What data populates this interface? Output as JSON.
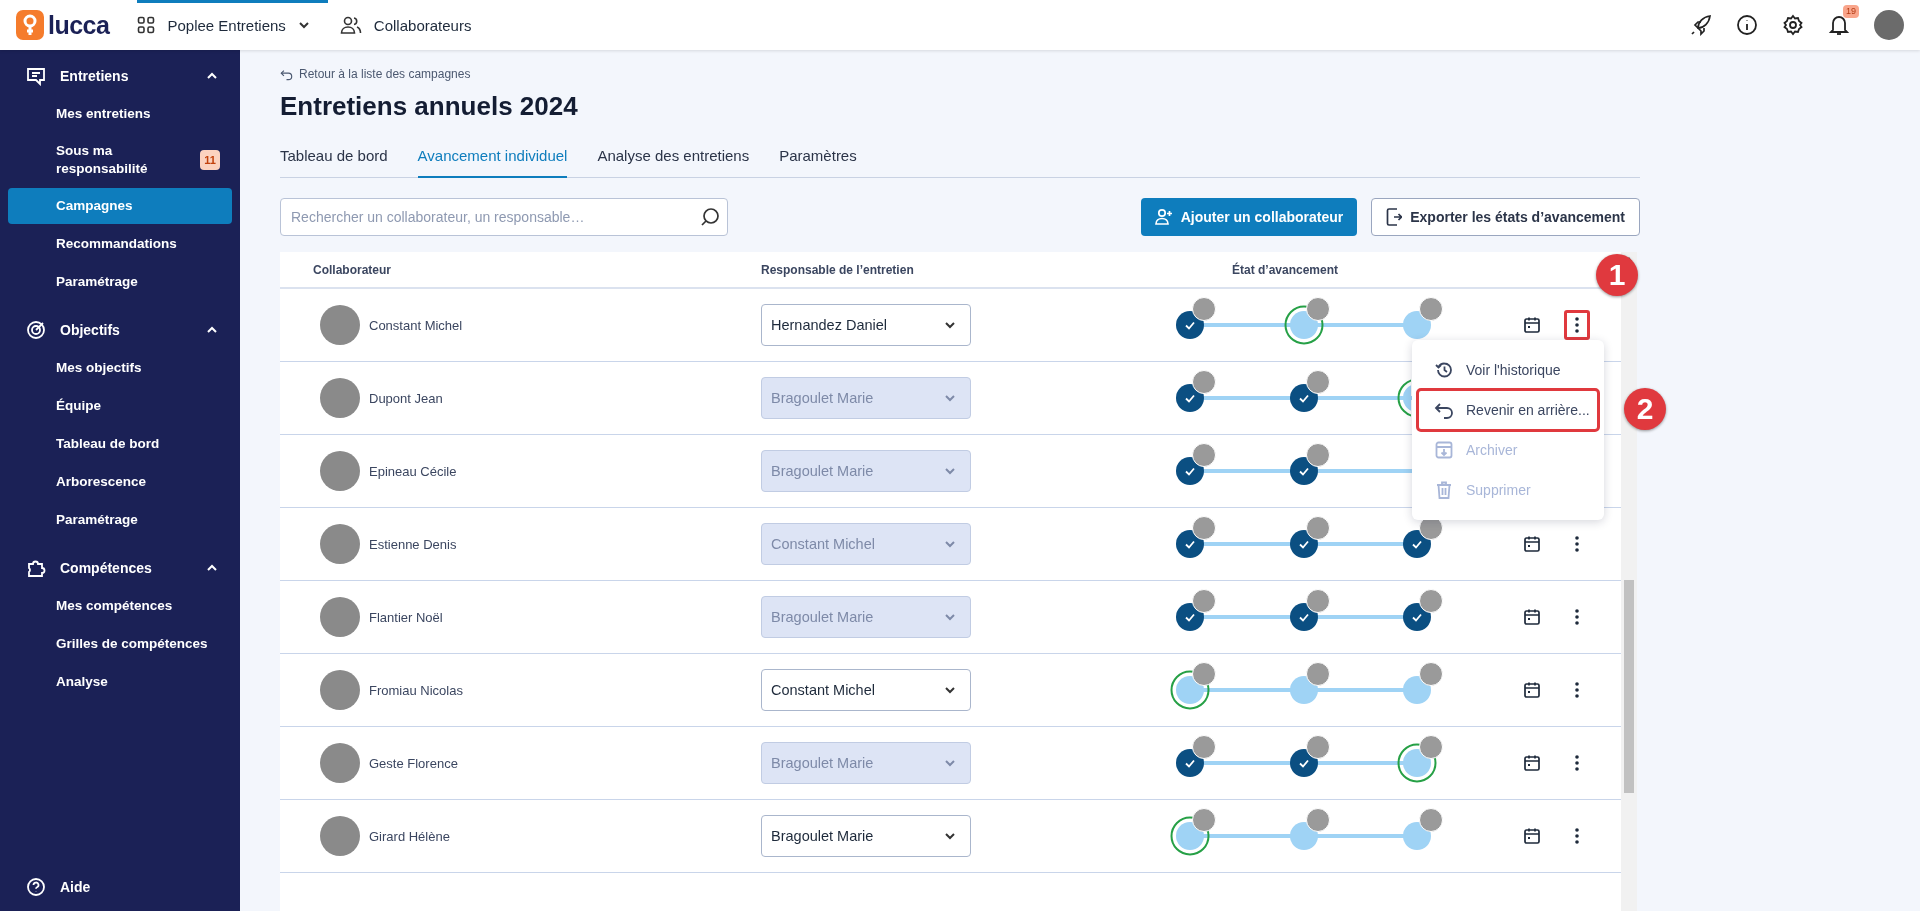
{
  "topbar": {
    "logo": "lucca",
    "apps": [
      {
        "label": "Poplee Entretiens",
        "selected": true,
        "dropdown": true
      },
      {
        "label": "Collaborateurs",
        "selected": false,
        "dropdown": false
      }
    ],
    "notifications": "19"
  },
  "sidebar": {
    "sections": [
      {
        "label": "Entretiens",
        "expanded": true,
        "items": [
          {
            "label": "Mes entretiens",
            "selected": false
          },
          {
            "label": "Sous ma responsabilité",
            "selected": false,
            "badge": "11"
          },
          {
            "label": "Campagnes",
            "selected": true
          },
          {
            "label": "Recommandations",
            "selected": false
          },
          {
            "label": "Paramétrage",
            "selected": false
          }
        ]
      },
      {
        "label": "Objectifs",
        "expanded": true,
        "items": [
          {
            "label": "Mes objectifs",
            "selected": false
          },
          {
            "label": "Équipe",
            "selected": false
          },
          {
            "label": "Tableau de bord",
            "selected": false
          },
          {
            "label": "Arborescence",
            "selected": false
          },
          {
            "label": "Paramétrage",
            "selected": false
          }
        ]
      },
      {
        "label": "Compétences",
        "expanded": true,
        "items": [
          {
            "label": "Mes compétences",
            "selected": false
          },
          {
            "label": "Grilles de compétences",
            "selected": false
          },
          {
            "label": "Analyse",
            "selected": false
          }
        ]
      }
    ],
    "help": "Aide"
  },
  "page": {
    "back_link": "Retour à la liste des campagnes",
    "title": "Entretiens annuels 2024",
    "tabs": [
      {
        "label": "Tableau de bord",
        "selected": false
      },
      {
        "label": "Avancement individuel",
        "selected": true
      },
      {
        "label": "Analyse des entretiens",
        "selected": false
      },
      {
        "label": "Paramètres",
        "selected": false
      }
    ],
    "search": {
      "placeholder": "Rechercher un collaborateur, un responsable…"
    },
    "buttons": [
      {
        "label": "Ajouter un collaborateur",
        "kind": "primary"
      },
      {
        "label": "Exporter les états d’avancement",
        "kind": "secondary"
      }
    ]
  },
  "table": {
    "columns": [
      "Collaborateur",
      "Responsable de l’entretien",
      "État d’avancement"
    ],
    "rows": [
      {
        "name": "Constant Michel",
        "manager": "Hernandez Daniel",
        "manager_disabled": false,
        "steps": [
          {
            "kind": "done"
          },
          {
            "kind": "current"
          },
          {
            "kind": "todo"
          }
        ],
        "context_menu": {
          "items": [
            {
              "label": "Voir l'historique",
              "disabled": false,
              "highlighted": false
            },
            {
              "label": "Revenir en arrière...",
              "disabled": false,
              "highlighted": true
            },
            {
              "label": "Archiver",
              "disabled": true,
              "highlighted": false
            },
            {
              "label": "Supprimer",
              "disabled": true,
              "highlighted": false
            }
          ]
        }
      },
      {
        "name": "Dupont Jean",
        "manager": "Bragoulet Marie",
        "manager_disabled": true,
        "steps": [
          {
            "kind": "done"
          },
          {
            "kind": "done"
          },
          {
            "kind": "current"
          }
        ]
      },
      {
        "name": "Epineau Cécile",
        "manager": "Bragoulet Marie",
        "manager_disabled": true,
        "steps": [
          {
            "kind": "done"
          },
          {
            "kind": "done"
          }
        ]
      },
      {
        "name": "Estienne Denis",
        "manager": "Constant Michel",
        "manager_disabled": true,
        "steps": [
          {
            "kind": "done"
          },
          {
            "kind": "done"
          },
          {
            "kind": "done"
          }
        ]
      },
      {
        "name": "Flantier Noël",
        "manager": "Bragoulet Marie",
        "manager_disabled": true,
        "steps": [
          {
            "kind": "done"
          },
          {
            "kind": "done"
          },
          {
            "kind": "done"
          }
        ]
      },
      {
        "name": "Fromiau Nicolas",
        "manager": "Constant Michel",
        "manager_disabled": false,
        "steps": [
          {
            "kind": "current"
          },
          {
            "kind": "todo"
          },
          {
            "kind": "todo"
          }
        ]
      },
      {
        "name": "Geste Florence",
        "manager": "Bragoulet Marie",
        "manager_disabled": true,
        "steps": [
          {
            "kind": "done"
          },
          {
            "kind": "done"
          },
          {
            "kind": "current"
          }
        ]
      },
      {
        "name": "Girard Hélène",
        "manager": "Bragoulet Marie",
        "manager_disabled": false,
        "steps": [
          {
            "kind": "current"
          },
          {
            "kind": "todo"
          },
          {
            "kind": "todo"
          }
        ]
      }
    ]
  },
  "annotations": [
    {
      "label": "1"
    },
    {
      "label": "2"
    }
  ]
}
